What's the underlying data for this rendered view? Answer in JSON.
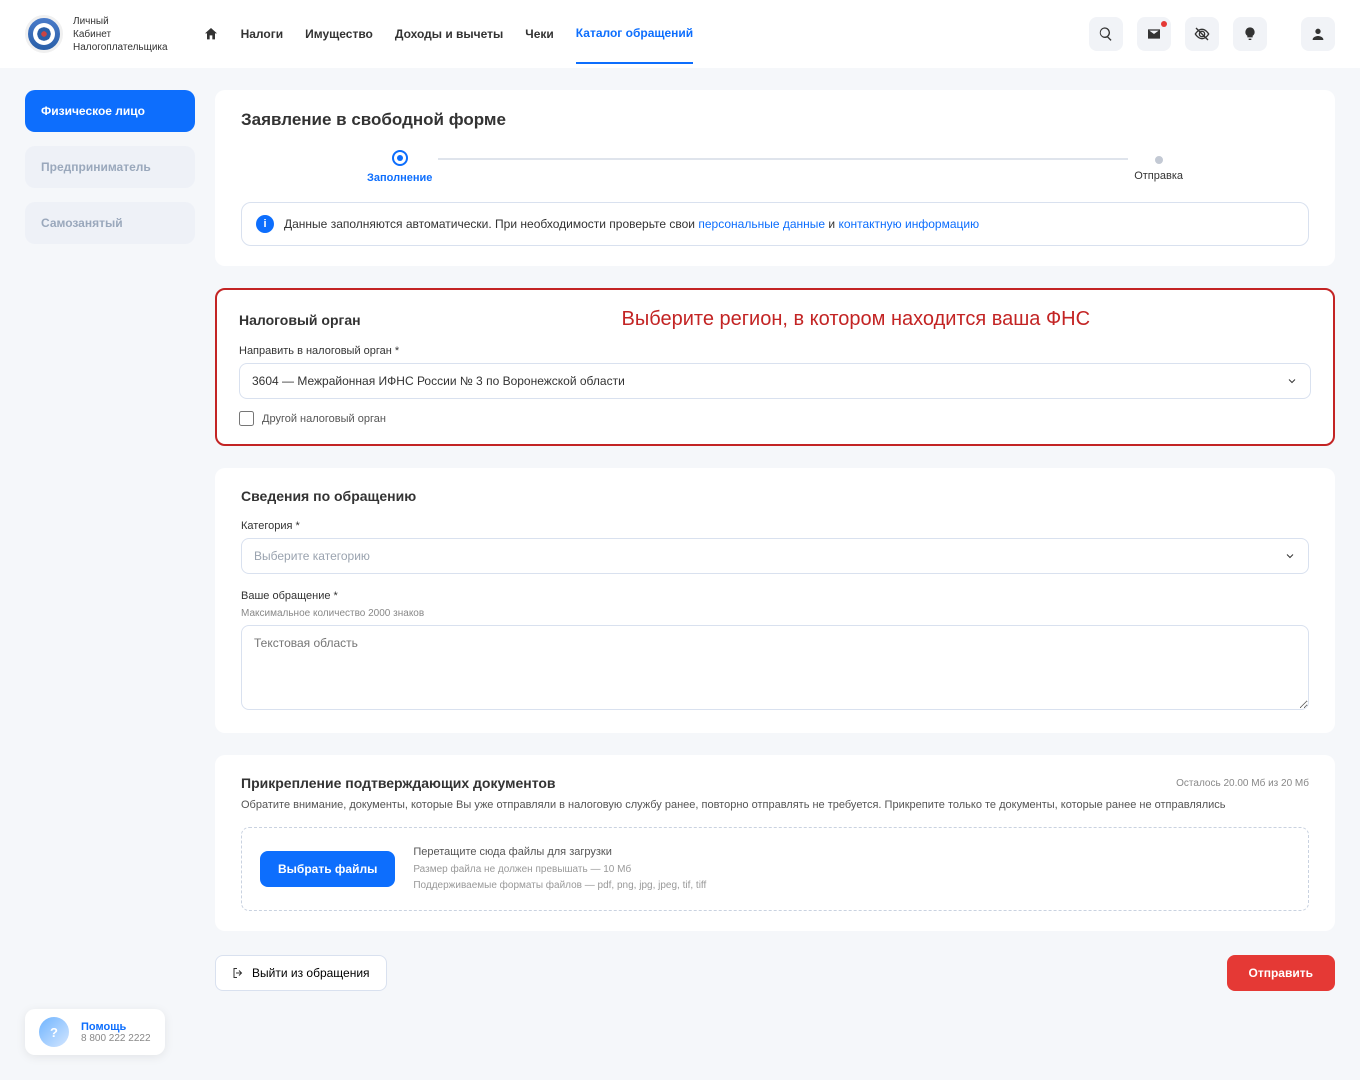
{
  "header": {
    "logo_line1": "Личный",
    "logo_line2": "Кабинет",
    "logo_line3": "Налогоплательщика",
    "nav": {
      "taxes": "Налоги",
      "property": "Имущество",
      "income": "Доходы и вычеты",
      "checks": "Чеки",
      "catalog": "Каталог обращений"
    }
  },
  "sidebar": {
    "individual": "Физическое лицо",
    "entrepreneur": "Предприниматель",
    "selfemployed": "Самозанятый"
  },
  "page": {
    "title": "Заявление в свободной форме",
    "step_fill": "Заполнение",
    "step_send": "Отправка",
    "info_prefix": "Данные заполняются автоматически. При необходимости проверьте свои ",
    "info_link1": "персональные данные",
    "info_mid": " и ",
    "info_link2": "контактную информацию"
  },
  "tax_org": {
    "section": "Налоговый орган",
    "highlight": "Выберите регион, в котором находится ваша ФНС",
    "label": "Направить в налоговый орган *",
    "value": "3604 — Межрайонная ИФНС России № 3 по Воронежской области",
    "other": "Другой налоговый орган"
  },
  "appeal": {
    "section": "Сведения по обращению",
    "cat_label": "Категория *",
    "cat_placeholder": "Выберите категорию",
    "msg_label": "Ваше обращение *",
    "msg_hint": "Максимальное количество 2000 знаков",
    "msg_placeholder": "Текстовая область"
  },
  "attach": {
    "section": "Прикрепление подтверждающих документов",
    "remain": "Осталось 20.00 Мб из 20 Мб",
    "note": "Обратите внимание, документы, которые Вы уже отправляли в налоговую службу ранее, повторно отправлять не требуется. Прикрепите только те документы, которые ранее не отправлялись",
    "select_btn": "Выбрать файлы",
    "drag": "Перетащите сюда файлы для загрузки",
    "size": "Размер файла не должен превышать — 10 Мб",
    "formats": "Поддерживаемые форматы файлов — pdf, png, jpg, jpeg, tif, tiff"
  },
  "footer": {
    "exit": "Выйти из обращения",
    "send": "Отправить"
  },
  "help": {
    "title": "Помощь",
    "phone": "8 800 222 2222",
    "q": "?"
  }
}
